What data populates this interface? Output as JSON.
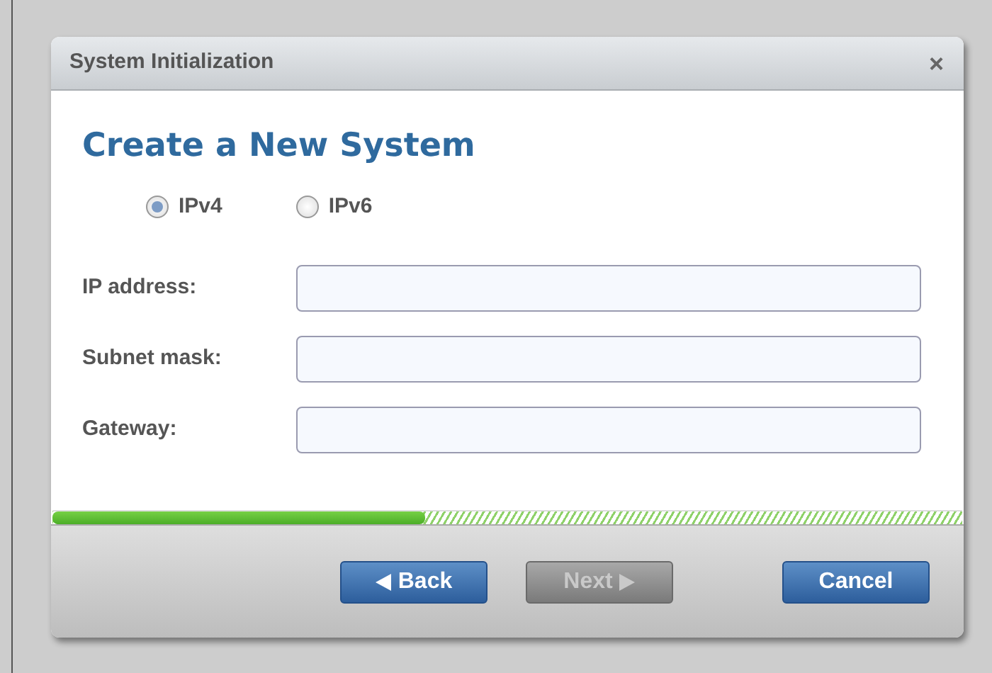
{
  "window": {
    "title": "System Initialization",
    "close": "×"
  },
  "heading": "Create a New System",
  "protocols": [
    {
      "label": "IPv4",
      "selected": true
    },
    {
      "label": "IPv6",
      "selected": false
    }
  ],
  "fields": [
    {
      "label": "IP address:"
    },
    {
      "label": "Subnet mask:"
    },
    {
      "label": "Gateway:"
    }
  ],
  "progress": {
    "level": 0.41
  },
  "buttons": [
    {
      "label": "Back",
      "kind": "back",
      "disabled": false
    },
    {
      "label": "Next",
      "kind": "next",
      "disabled": true
    },
    {
      "label": "Cancel",
      "kind": "plain",
      "disabled": false
    }
  ]
}
